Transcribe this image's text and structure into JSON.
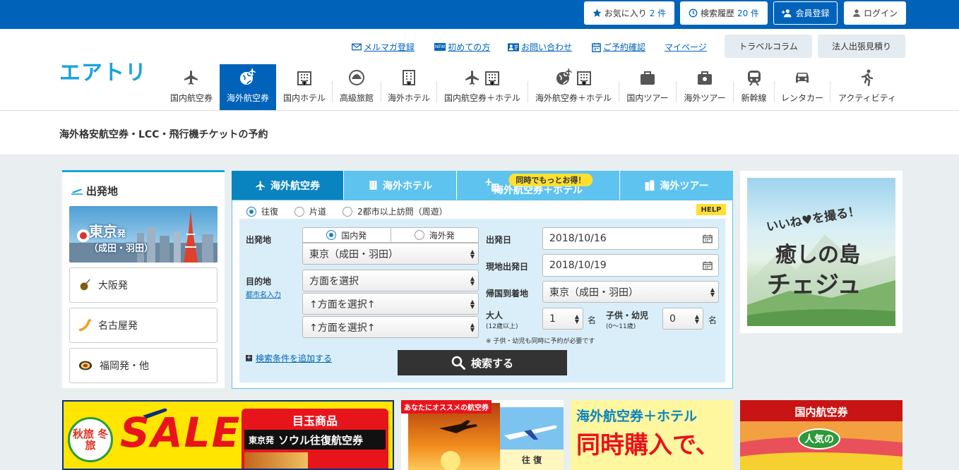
{
  "topbar": {
    "favorites": {
      "label": "お気に入り",
      "count": "2 件"
    },
    "history": {
      "label": "検索履歴",
      "count": "20 件"
    },
    "register": "会員登録",
    "login": "ログイン"
  },
  "header": {
    "logo": "エアトリ",
    "links": [
      "メルマガ登録",
      "初めての方",
      "お問い合わせ",
      "ご予約確認",
      "マイページ"
    ],
    "new_badge": "NEW",
    "gray_buttons": [
      "トラベルコラム",
      "法人出張見積り"
    ]
  },
  "nav": {
    "items": [
      "国内航空券",
      "海外航空券",
      "国内ホテル",
      "高級旅館",
      "海外ホテル",
      "国内航空券＋ホテル",
      "海外航空券＋ホテル",
      "国内ツアー",
      "海外ツアー",
      "新幹線",
      "レンタカー",
      "アクティビティ"
    ],
    "active_index": 1
  },
  "page_title": "海外格安航空券・LCC・飛行機チケットの予約",
  "departure": {
    "title": "出発地",
    "tokyo": {
      "city": "東京",
      "suffix": "発",
      "airports": "（成田・羽田）"
    },
    "items": [
      "大阪発",
      "名古屋発",
      "福岡発・他"
    ]
  },
  "search": {
    "tabs": [
      "海外航空券",
      "海外ホテル",
      "海外航空券＋ホテル",
      "海外ツアー"
    ],
    "tab_badge": "同時でもっとお得！",
    "trip_types": [
      "往復",
      "片道",
      "2都市以上訪問（周遊）"
    ],
    "help": "HELP",
    "origin_label": "出発地",
    "origin_types": [
      "国内発",
      "海外発"
    ],
    "origin_value": "東京（成田・羽田）",
    "dest_label": "目的地",
    "dest_link": "都市名入力",
    "dest_values": [
      "方面を選択",
      "↑方面を選択↑",
      "↑方面を選択↑"
    ],
    "depart_label": "出発日",
    "depart_value": "2018/10/16",
    "local_depart_label": "現地出発日",
    "local_depart_value": "2018/10/19",
    "return_label": "帰国到着地",
    "return_value": "東京（成田・羽田）",
    "adult_label": "大人",
    "adult_sub": "(12歳以上)",
    "adult_value": "1",
    "child_label": "子供・幼児",
    "child_sub": "(0〜11歳)",
    "child_value": "0",
    "unit": "名",
    "note": "※ 子供・幼児も同時に予約が必要です",
    "add_conditions": "検索条件を追加する",
    "submit": "検索する"
  },
  "ad": {
    "line1": "いいね♥を撮る！",
    "line2": "癒しの島",
    "line3": "チェジュ"
  },
  "banners": {
    "b1": {
      "tag": "秋旅 冬旅",
      "sale": "SALE",
      "heading": "目玉商品",
      "sub": "東京発",
      "product": "ソウル往復航空券"
    },
    "b2": {
      "ribbon": "あなたにオススメの航空券",
      "label": "往 復"
    },
    "b3": {
      "line1": "海外航空券＋ホテル",
      "line2": "同時購入で、"
    },
    "b4": {
      "heading": "国内航空券",
      "badge": "人気の"
    }
  }
}
